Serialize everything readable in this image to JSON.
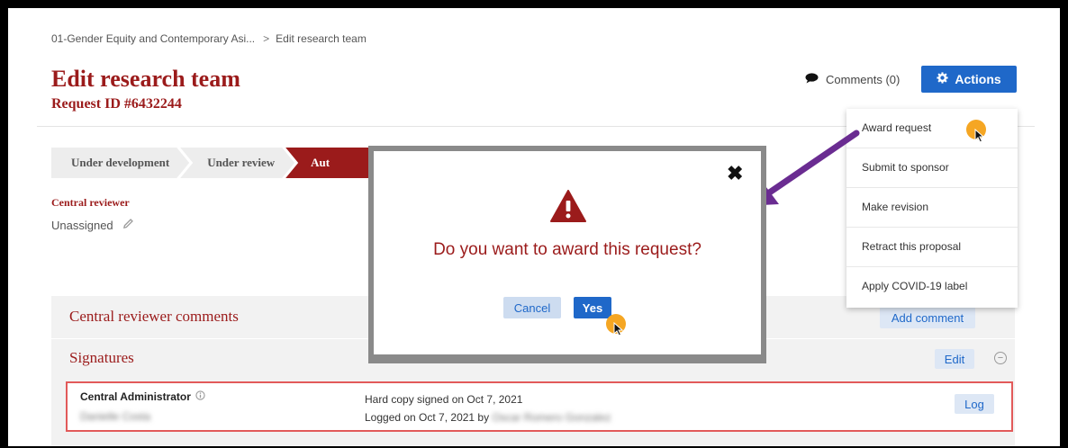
{
  "breadcrumb": {
    "parent": "01-Gender Equity and Contemporary Asi...",
    "separator": ">",
    "current": "Edit research team"
  },
  "header": {
    "title": "Edit research team",
    "request_id": "Request ID #6432244"
  },
  "toolbar": {
    "comments_label": "Comments (0)",
    "actions_label": "Actions"
  },
  "workflow": {
    "steps": [
      "Under development",
      "Under review",
      "Aut"
    ]
  },
  "central_reviewer": {
    "label": "Central reviewer",
    "value": "Unassigned"
  },
  "sections": {
    "comments": {
      "title": "Central reviewer comments",
      "button": "Add comment"
    },
    "signatures": {
      "title": "Signatures",
      "edit_button": "Edit",
      "collapse_glyph": "−"
    }
  },
  "signature_row": {
    "role": "Central Administrator",
    "person": "Danielle Costa",
    "line1": "Hard copy signed on Oct 7, 2021",
    "line2_prefix": "Logged on Oct 7, 2021 by",
    "line2_name": "Oscar Romero Gonzalez",
    "log_button": "Log"
  },
  "actions_menu": {
    "items": [
      "Award request",
      "Submit to sponsor",
      "Make revision",
      "Retract this proposal",
      "Apply COVID-19 label"
    ]
  },
  "dialog": {
    "question": "Do you want to award this request?",
    "cancel_label": "Cancel",
    "yes_label": "Yes",
    "close_glyph": "✖"
  },
  "colors": {
    "brand_red": "#9b1b1b",
    "primary_blue": "#1f68c9",
    "annotation_purple": "#6a2c91",
    "highlight_red": "#e25a5a",
    "cursor_orange": "#f5a623"
  }
}
